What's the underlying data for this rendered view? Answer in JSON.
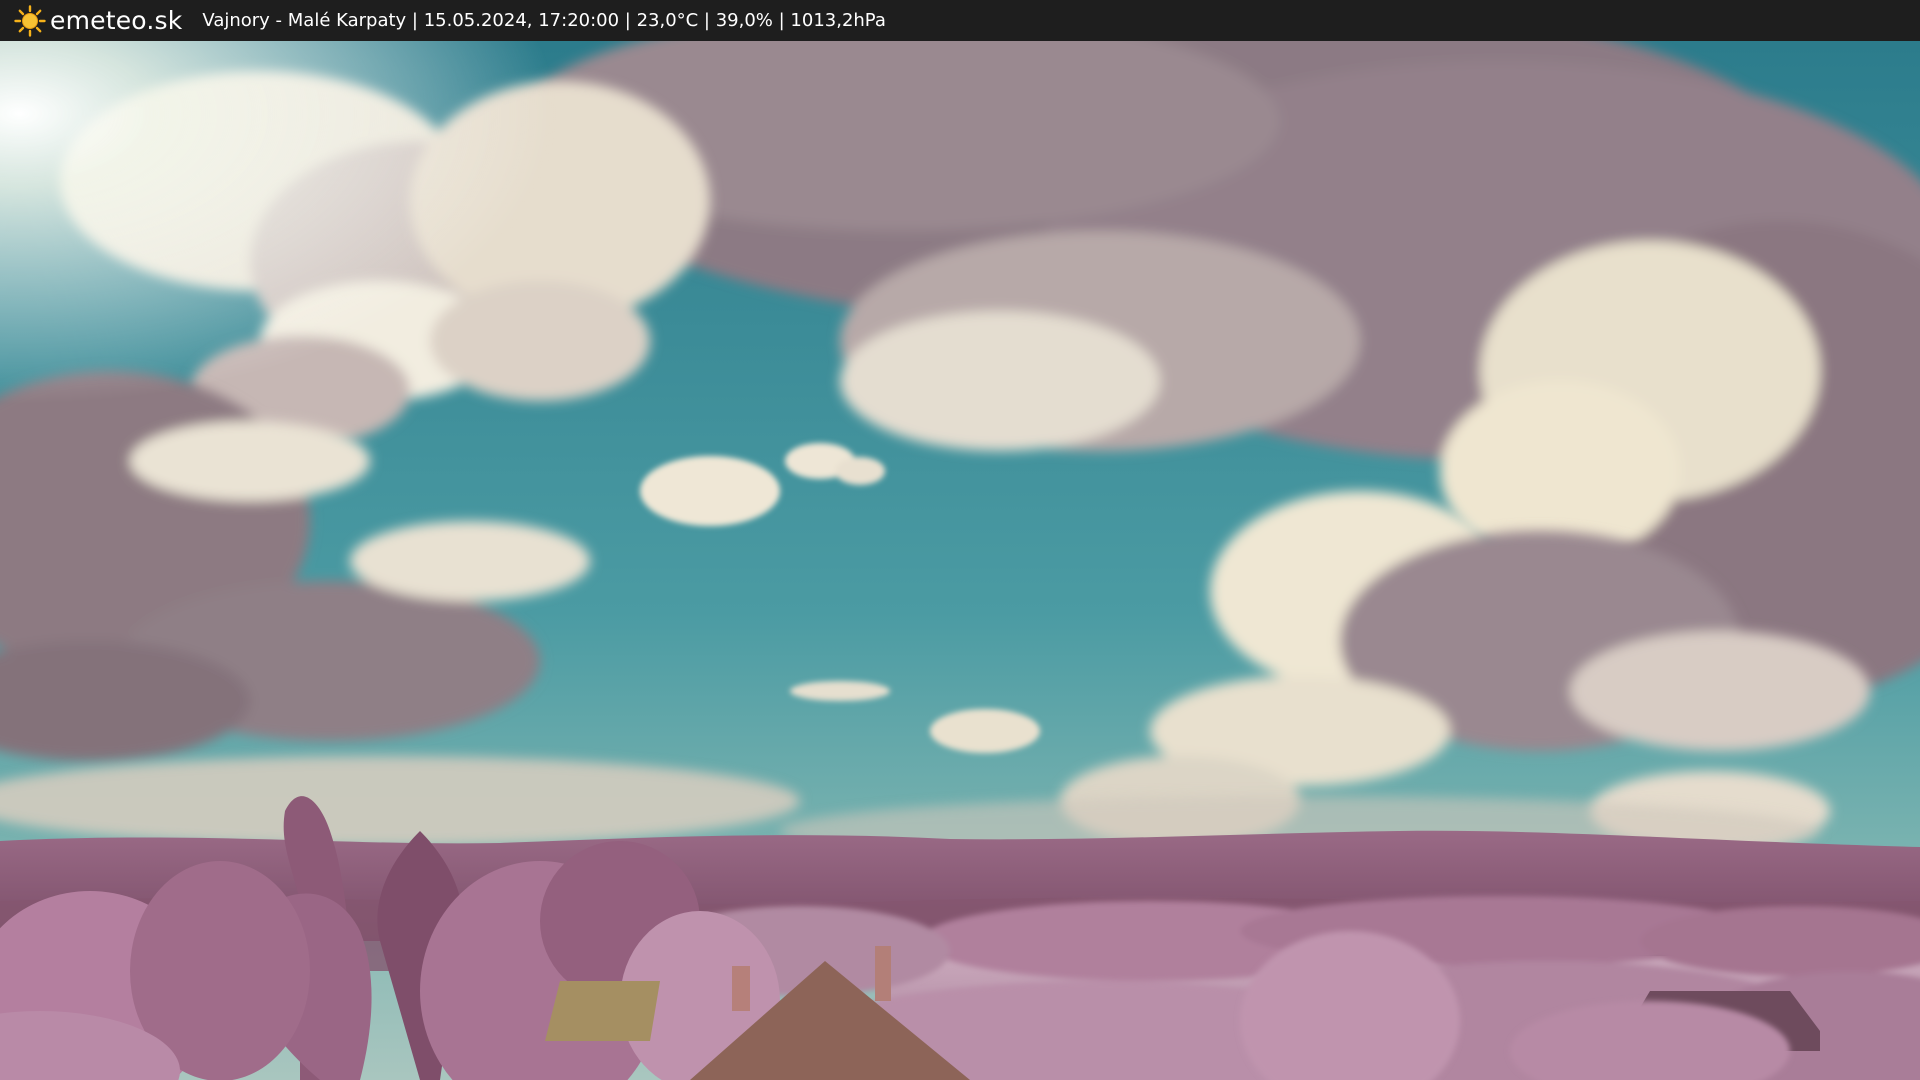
{
  "header": {
    "brand": "emeteo.sk",
    "brand_icon": "sun-icon",
    "caption": "Vajnory - Malé Karpaty | 15.05.2024, 17:20:00 | 23,0°C | 39,0% | 1013,2hPa"
  },
  "scene": {
    "description_icon": "webcam-landscape-image"
  },
  "colors": {
    "topbar": "#1e1e1e",
    "sky_top": "#2f7e8e",
    "sky_bottom": "#5fa5a8",
    "hills": "#8a5a72",
    "foliage": "#b07c9c",
    "sun": "#f6c342"
  }
}
